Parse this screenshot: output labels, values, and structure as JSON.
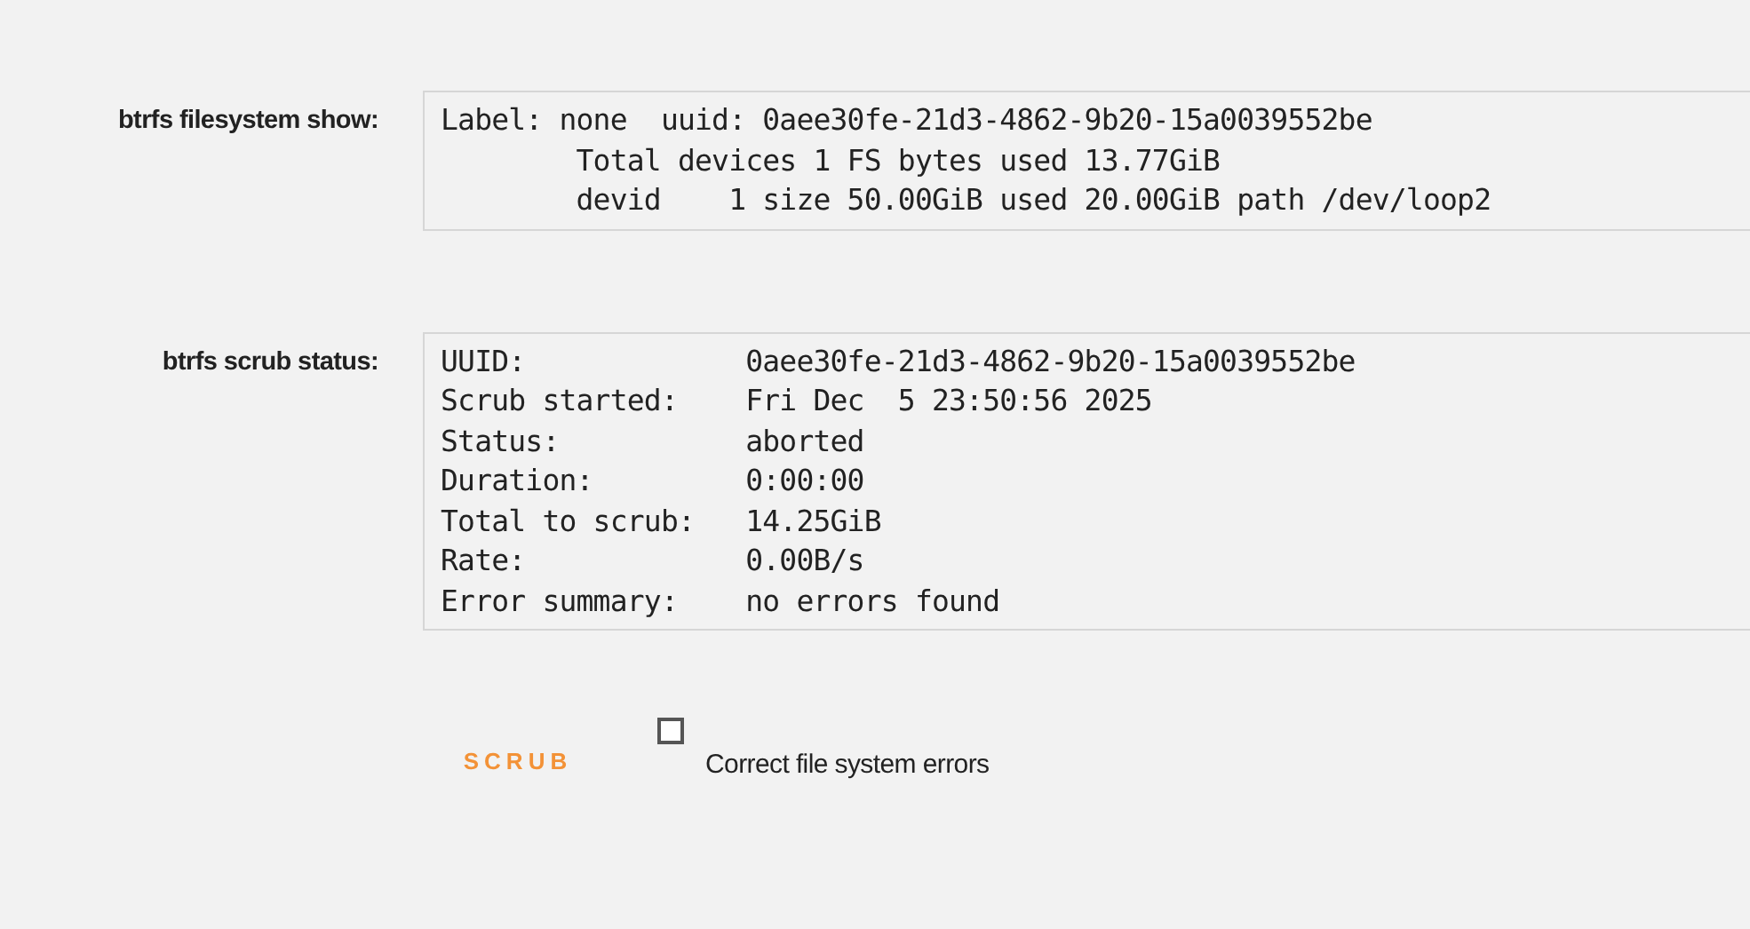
{
  "sections": [
    {
      "label": "btrfs filesystem show:",
      "lines": [
        "Label: none  uuid: 0aee30fe-21d3-4862-9b20-15a0039552be",
        "        Total devices 1 FS bytes used 13.77GiB",
        "        devid    1 size 50.00GiB used 20.00GiB path /dev/loop2"
      ]
    },
    {
      "label": "btrfs scrub status:",
      "lines": [
        "UUID:             0aee30fe-21d3-4862-9b20-15a0039552be",
        "Scrub started:    Fri Dec  5 23:50:56 2025",
        "Status:           aborted",
        "Duration:         0:00:00",
        "Total to scrub:   14.25GiB",
        "Rate:             0.00B/s",
        "Error summary:    no errors found"
      ]
    }
  ],
  "scrub_button": {
    "label": "SCRUB"
  },
  "correct_errors": {
    "label": "Correct file system errors",
    "checked": false
  }
}
